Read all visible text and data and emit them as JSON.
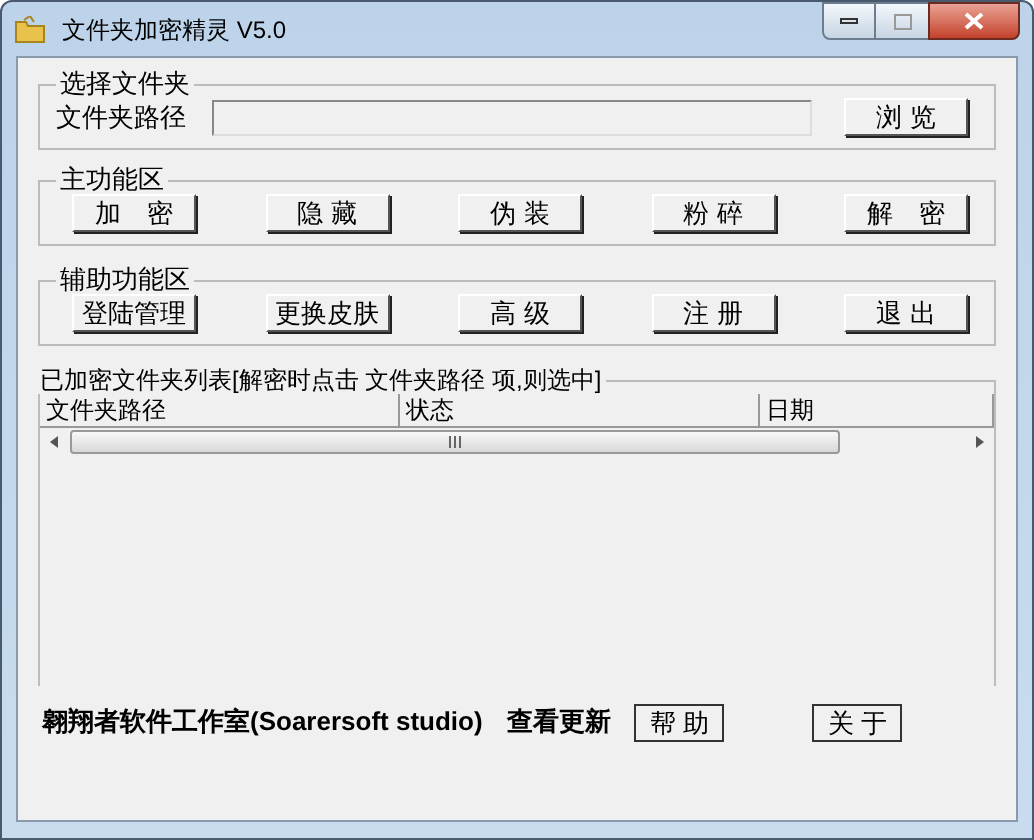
{
  "window": {
    "title": "文件夹加密精灵 V5.0"
  },
  "select_folder": {
    "title": "选择文件夹",
    "label": "文件夹路径",
    "browse_button": "浏 览"
  },
  "main_functions": {
    "title": "主功能区",
    "buttons": [
      "加　密",
      "隐 藏",
      "伪 装",
      "粉 碎",
      "解　密"
    ]
  },
  "aux_functions": {
    "title": "辅助功能区",
    "buttons": [
      "登陆管理",
      "更换皮肤",
      "高 级",
      "注 册",
      "退 出"
    ]
  },
  "encrypted_list": {
    "title": "已加密文件夹列表[解密时点击 文件夹路径 项,则选中]",
    "columns": [
      "文件夹路径",
      "状态",
      "日期"
    ]
  },
  "footer": {
    "studio": "翱翔者软件工作室(Soarersoft studio)",
    "check_update": "查看更新",
    "buttons": [
      "帮 助",
      "关 于"
    ]
  }
}
